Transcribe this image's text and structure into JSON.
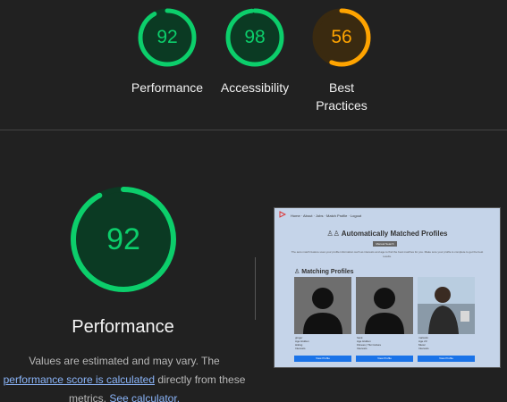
{
  "colors": {
    "good": "#0cce6b",
    "average": "#ffa400",
    "background": "#212121",
    "link": "#8ab4f8"
  },
  "gauges": [
    {
      "score": "92",
      "label": "Performance",
      "value": 92,
      "color": "#0cce6b"
    },
    {
      "score": "98",
      "label": "Accessibility",
      "value": 98,
      "color": "#0cce6b"
    },
    {
      "score": "56",
      "label_line1": "Best",
      "label_line2": "Practices",
      "value": 56,
      "color": "#ffa400"
    }
  ],
  "main": {
    "score": "92",
    "value": 92,
    "title": "Performance",
    "desc_before": "Values are estimated and may vary. The",
    "desc_link1": "performance score is calculated",
    "desc_middle": "directly from these metrics.",
    "desc_link2": "See calculator."
  },
  "thumbnail": {
    "nav": "Home · About · Jobs · Match Profile · Logout",
    "title": "Automatically Matched Profiles",
    "button": "Manual Search",
    "text": "The auto match feature uses your profile information such as interests and age to find the best matches for you. Make sure your profile is complete to get the best results.",
    "section": "Matching Profiles",
    "cards": [
      {
        "name": "ginger",
        "line1": "Age Hidden",
        "line2": "Hiking",
        "line3": "Interests",
        "button": "View Profile"
      },
      {
        "name": "hank",
        "line1": "Age Hidden",
        "line2": "Fitness | Tiki Culture",
        "line3": "Interests",
        "button": "View Profile"
      },
      {
        "name": "malcolm",
        "line1": "Age 23",
        "line2": "Music",
        "line3": "Interests",
        "button": "View Profile"
      }
    ]
  }
}
